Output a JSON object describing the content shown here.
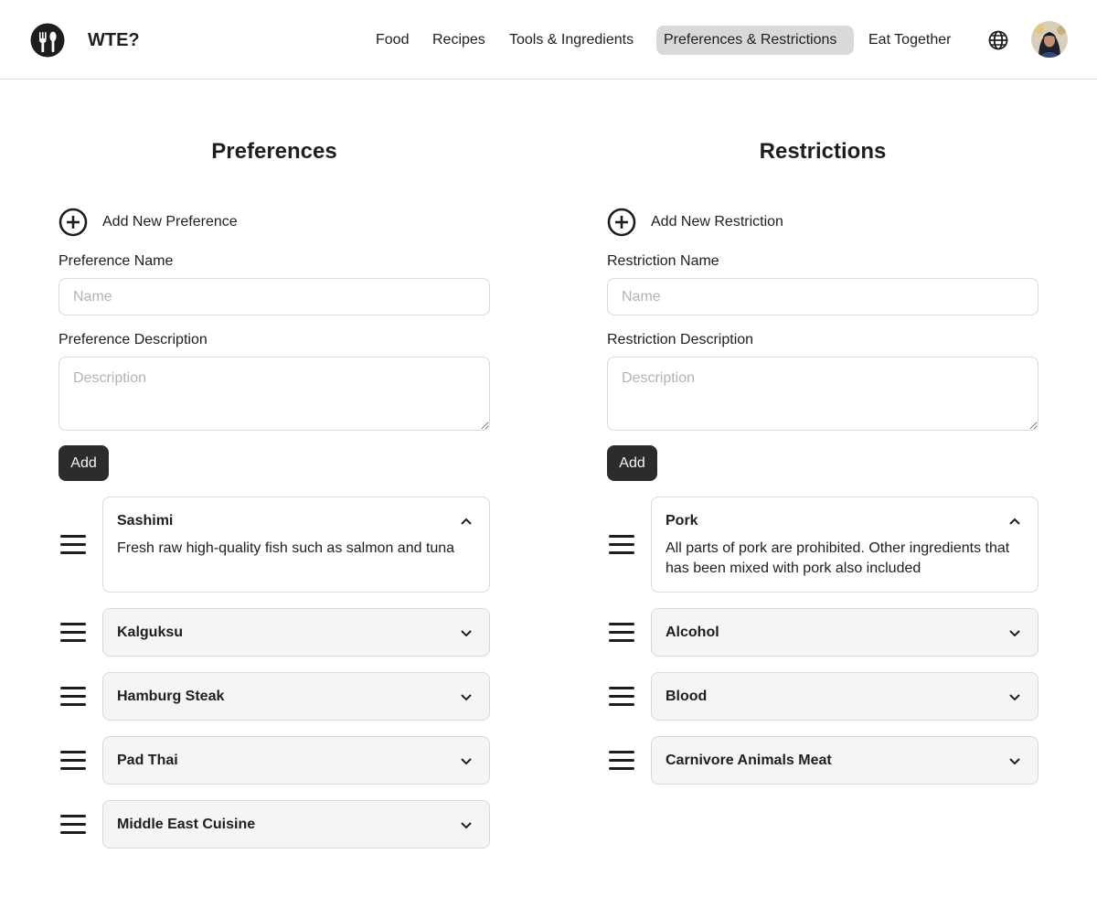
{
  "app": {
    "brand": "WTE?",
    "logo_icon": "fork-knife-icon"
  },
  "nav": {
    "items": [
      {
        "label": "Food"
      },
      {
        "label": "Recipes"
      },
      {
        "label": "Tools & Ingredients"
      },
      {
        "label": "Preferences & Restrictions",
        "active": true
      },
      {
        "label": "Eat Together"
      }
    ],
    "language_icon": "globe-icon",
    "avatar_icon": "user-avatar"
  },
  "preferences": {
    "title": "Preferences",
    "add_new_label": "Add New Preference",
    "name_label": "Preference Name",
    "name_placeholder": "Name",
    "name_value": "",
    "description_label": "Preference Description",
    "description_placeholder": "Description",
    "description_value": "",
    "add_button": "Add",
    "items": [
      {
        "title": "Sashimi",
        "expanded": true,
        "description": "Fresh raw high-quality fish such as salmon and tuna"
      },
      {
        "title": "Kalguksu",
        "expanded": false
      },
      {
        "title": "Hamburg Steak",
        "expanded": false
      },
      {
        "title": "Pad Thai",
        "expanded": false
      },
      {
        "title": "Middle East Cuisine",
        "expanded": false
      }
    ]
  },
  "restrictions": {
    "title": "Restrictions",
    "add_new_label": "Add New Restriction",
    "name_label": "Restriction Name",
    "name_placeholder": "Name",
    "name_value": "",
    "description_label": "Restriction Description",
    "description_placeholder": "Description",
    "description_value": "",
    "add_button": "Add",
    "items": [
      {
        "title": "Pork",
        "expanded": true,
        "description": "All parts of pork are prohibited. Other ingredients that has been mixed with pork also included"
      },
      {
        "title": "Alcohol",
        "expanded": false
      },
      {
        "title": "Blood",
        "expanded": false
      },
      {
        "title": "Carnivore Animals Meat",
        "expanded": false
      }
    ]
  },
  "colors": {
    "text": "#1e1e1e",
    "border": "#d9d9d9",
    "card_collapsed_bg": "#f5f5f5",
    "active_nav_bg": "#d9d9d9",
    "button_bg": "#2c2c2c",
    "button_text": "#f5f5f5",
    "placeholder": "#b3b3b3"
  }
}
